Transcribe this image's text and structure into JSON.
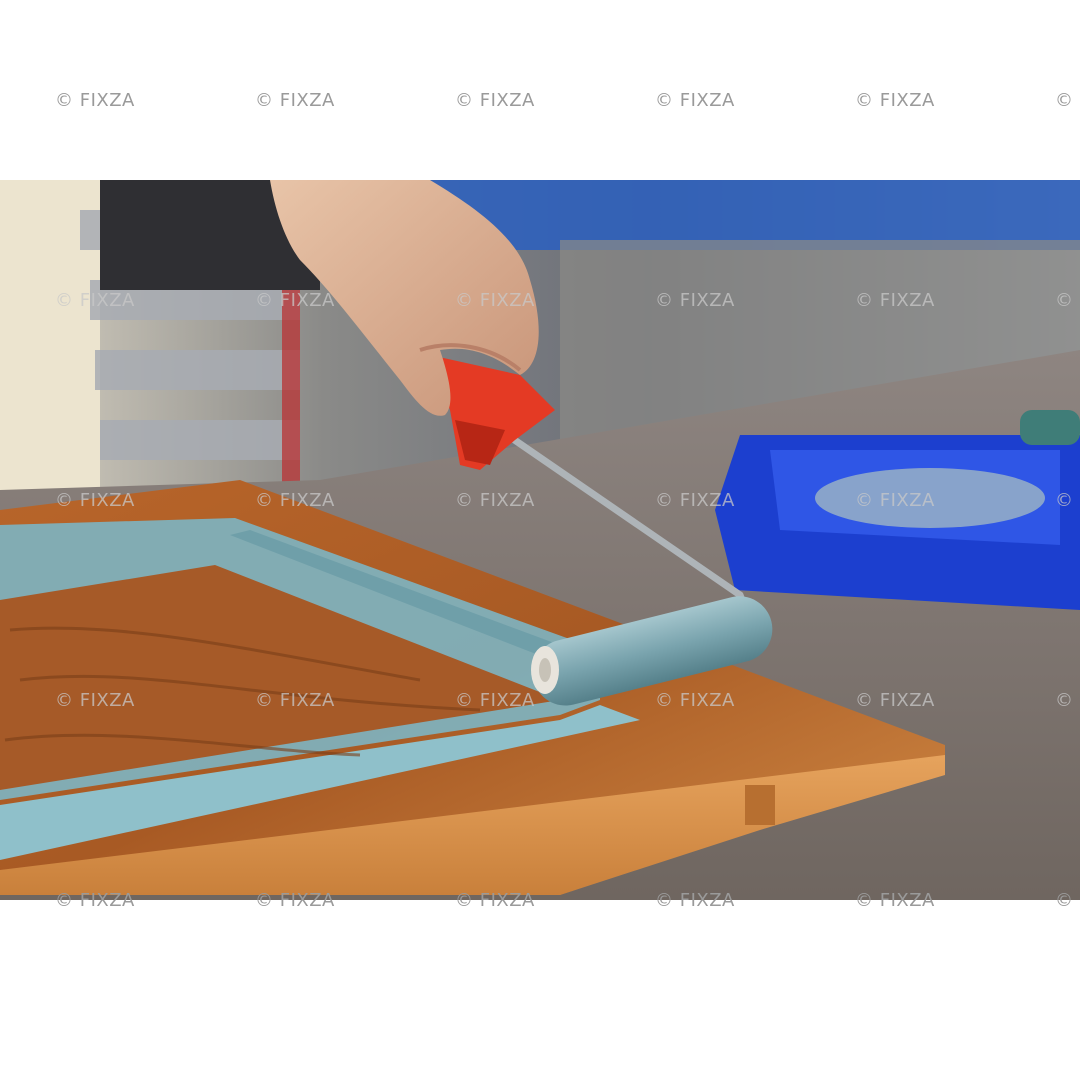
{
  "watermark": {
    "text": "© FIXZA",
    "partial_text": "©"
  },
  "photo": {
    "subject": "hand-painting-cabinet-door",
    "colors": {
      "paint": "#7fb0bb",
      "wood": "#c97a35",
      "handle": "#e43a24",
      "tray": "#1c3fcf",
      "felt": "#8a8079"
    }
  }
}
